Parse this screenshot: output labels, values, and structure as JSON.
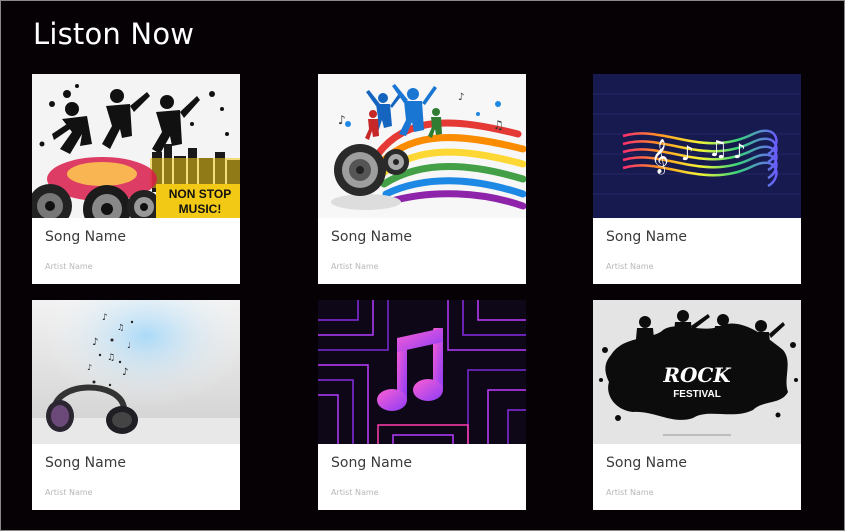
{
  "page": {
    "title": "Liston Now"
  },
  "cards": [
    {
      "song": "Song Name",
      "artist": "Artist Name",
      "art_icon": "dance-party-speakers-art",
      "art_text": [
        "NON STOP",
        "MUSIC!"
      ]
    },
    {
      "song": "Song Name",
      "artist": "Artist Name",
      "art_icon": "colorful-speaker-dancers-art"
    },
    {
      "song": "Song Name",
      "artist": "Artist Name",
      "art_icon": "neon-music-notes-art"
    },
    {
      "song": "Song Name",
      "artist": "Artist Name",
      "art_icon": "headphones-notes-art"
    },
    {
      "song": "Song Name",
      "artist": "Artist Name",
      "art_icon": "neon-music-app-icon-art"
    },
    {
      "song": "Song Name",
      "artist": "Artist Name",
      "art_icon": "rock-festival-art",
      "art_text": [
        "ROCK",
        "FESTIVAL"
      ]
    }
  ]
}
